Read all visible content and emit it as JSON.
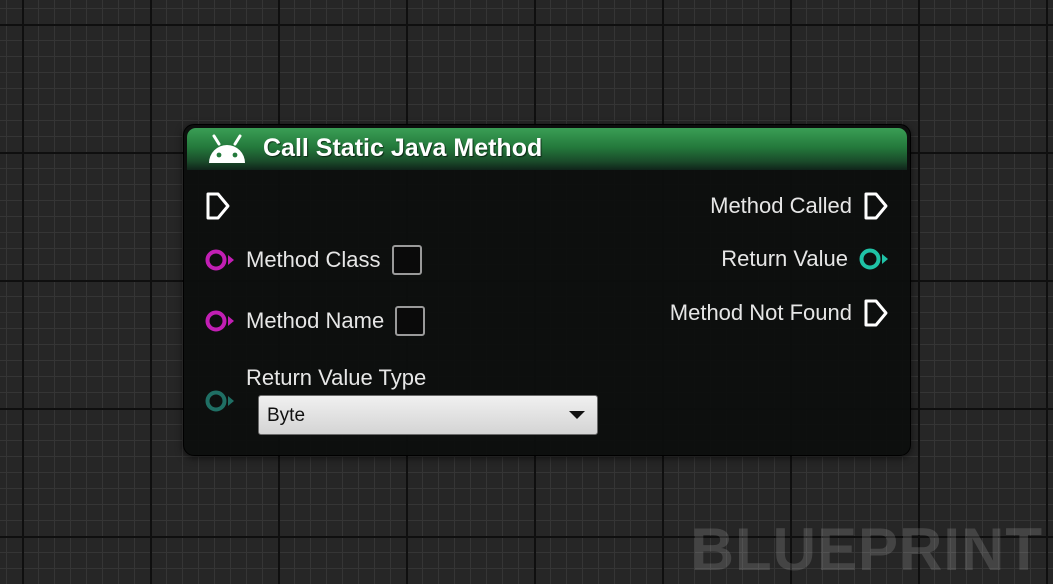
{
  "watermark": "BLUEPRINT",
  "node": {
    "title": "Call Static Java Method",
    "header_icon": "android-icon",
    "inputs": {
      "exec_icon": "exec-in-pin-icon",
      "method_class": {
        "label": "Method Class",
        "color": "#c21fb4"
      },
      "method_name": {
        "label": "Method Name",
        "color": "#c21fb4"
      },
      "return_value_type": {
        "label": "Return Value Type",
        "color": "#1f6f64",
        "selected": "Byte"
      }
    },
    "outputs": {
      "method_called": {
        "label": "Method Called"
      },
      "return_value": {
        "label": "Return Value",
        "color": "#1fc2a6"
      },
      "method_not_found": {
        "label": "Method Not Found"
      }
    }
  },
  "colors": {
    "header_green": "#247a3c",
    "string_pin": "#c21fb4",
    "byte_pin": "#1fc2a6",
    "exec_pin": "#ffffff"
  }
}
